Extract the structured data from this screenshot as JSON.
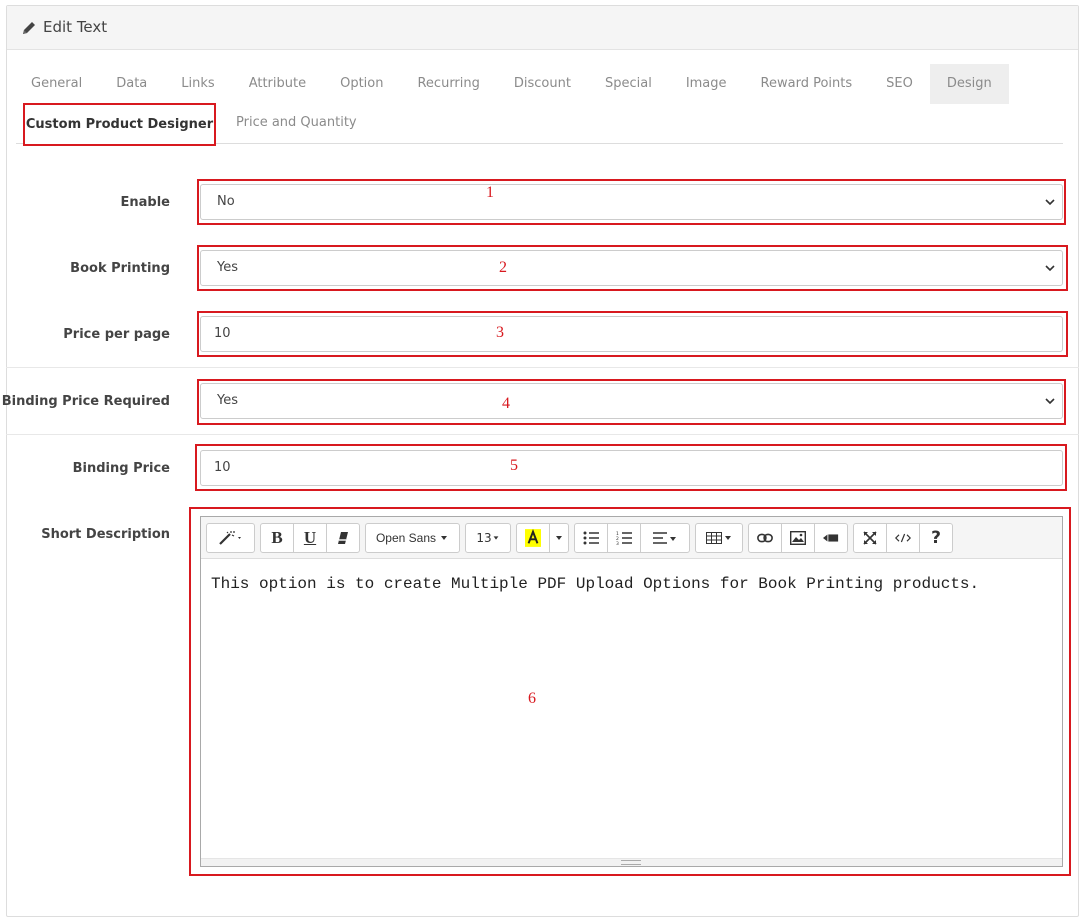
{
  "panel": {
    "title": "Edit Text",
    "icon": "pencil-icon"
  },
  "tabs": [
    {
      "label": "General"
    },
    {
      "label": "Data"
    },
    {
      "label": "Links"
    },
    {
      "label": "Attribute"
    },
    {
      "label": "Option"
    },
    {
      "label": "Recurring"
    },
    {
      "label": "Discount"
    },
    {
      "label": "Special"
    },
    {
      "label": "Image"
    },
    {
      "label": "Reward Points"
    },
    {
      "label": "SEO"
    },
    {
      "label": "Design"
    }
  ],
  "tabs_row2": {
    "active": "Custom Product Designer",
    "other": "Price and Quantity"
  },
  "form": {
    "enable": {
      "label": "Enable",
      "value": "No"
    },
    "book_printing": {
      "label": "Book Printing",
      "value": "Yes"
    },
    "price_per_page": {
      "label": "Price per page",
      "value": "10"
    },
    "binding_required": {
      "label": "Binding Price Required",
      "value": "Yes"
    },
    "binding_price": {
      "label": "Binding Price",
      "value": "10"
    },
    "short_description": {
      "label": "Short Description"
    }
  },
  "annotations": [
    "1",
    "2",
    "3",
    "4",
    "5",
    "6"
  ],
  "editor": {
    "font_family": "Open Sans",
    "font_size": "13",
    "bold": "B",
    "underline": "U",
    "help": "?",
    "content": "This option is to create Multiple PDF Upload Options for Book Printing products."
  },
  "colors": {
    "annotation_red": "#d8191f",
    "highlight_yellow": "#ffff00"
  }
}
